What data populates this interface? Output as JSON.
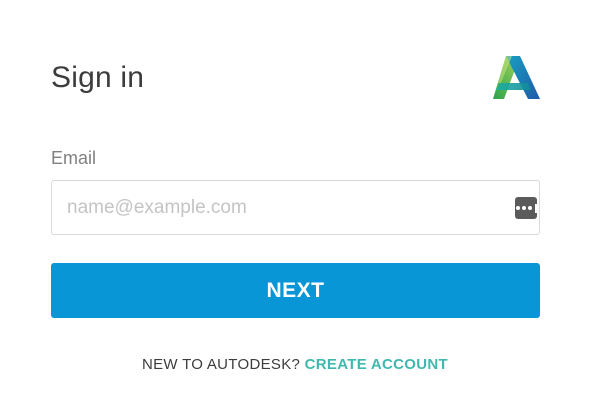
{
  "header": {
    "title": "Sign in",
    "logo_icon": "autodesk-logo-icon"
  },
  "form": {
    "email_label": "Email",
    "email_value": "",
    "email_placeholder": "name@example.com",
    "field_icon": "password-manager-dots-icon",
    "next_label": "NEXT"
  },
  "footer": {
    "prompt": "NEW TO AUTODESK?",
    "create_account_label": "CREATE ACCOUNT"
  },
  "colors": {
    "accent_button": "#0896d7",
    "link": "#3fb8b0",
    "text": "#3c3c3c",
    "label": "#808080",
    "logo_light_green": "#9fcf57",
    "logo_teal": "#1aa89b",
    "logo_blue": "#1b64b0"
  }
}
